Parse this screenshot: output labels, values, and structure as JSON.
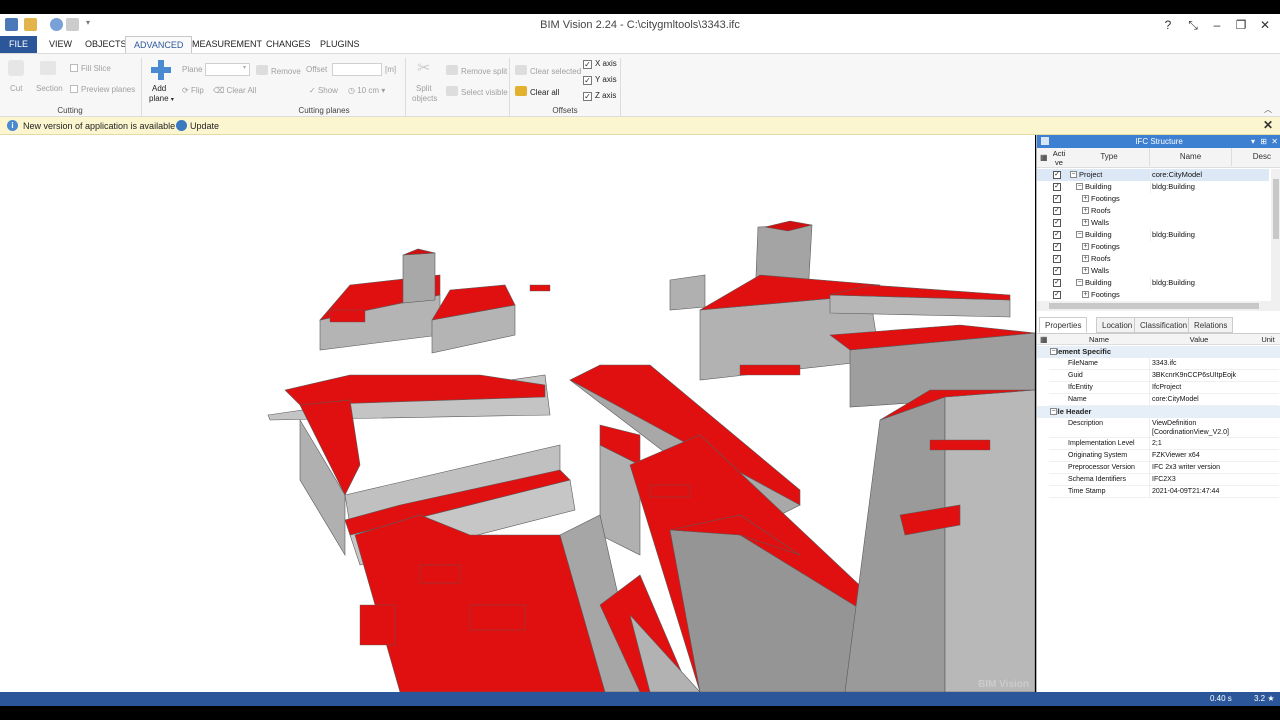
{
  "window": {
    "title": "BIM Vision 2.24 - C:\\citygmltools\\3343.ifc",
    "controls": [
      "?",
      "⤡",
      "–",
      "❐",
      "✕"
    ]
  },
  "menu": {
    "tabs": [
      "FILE",
      "VIEW",
      "OBJECTS",
      "ADVANCED",
      "MEASUREMENT",
      "CHANGES",
      "PLUGINS"
    ]
  },
  "ribbon": {
    "cut": "Cut",
    "section": "Section",
    "fill_slice": "Fill Slice",
    "preview_planes": "Preview planes",
    "cutting_group": "Cutting",
    "add_plane": "Add",
    "add_plane2": "plane",
    "plane_label": "Plane",
    "remove": "Remove",
    "flip": "Flip",
    "clear_all_planes": "Clear All",
    "offset_label": "Offset",
    "offset_unit": "[m]",
    "show": "Show",
    "step": "10 cm",
    "cutting_planes_group": "Cutting planes",
    "split_objects": "Split",
    "split_objects2": "objects",
    "remove_split": "Remove split",
    "select_visible": "Select visible",
    "clear_selected": "Clear selected",
    "clear_all": "Clear all",
    "offsets_group": "Offsets",
    "x_axis": "X axis",
    "y_axis": "Y axis",
    "z_axis": "Z axis"
  },
  "notification": {
    "message": "New version of application is available",
    "action": "Update"
  },
  "viewport": {
    "watermark": "BIM Vision"
  },
  "ifc": {
    "title": "IFC Structure",
    "cols": {
      "active": "Acti",
      "active2": "ve",
      "type": "Type",
      "name": "Name",
      "desc": "Desc"
    },
    "rows": [
      {
        "type": "Project",
        "name": "core:CityModel",
        "indent": 0,
        "sign": "−"
      },
      {
        "type": "Building",
        "name": "bldg:Building",
        "indent": 1,
        "sign": "−"
      },
      {
        "type": "Footings",
        "name": "",
        "indent": 2,
        "sign": "+"
      },
      {
        "type": "Roofs",
        "name": "",
        "indent": 2,
        "sign": "+"
      },
      {
        "type": "Walls",
        "name": "",
        "indent": 2,
        "sign": "+"
      },
      {
        "type": "Building",
        "name": "bldg:Building",
        "indent": 1,
        "sign": "−"
      },
      {
        "type": "Footings",
        "name": "",
        "indent": 2,
        "sign": "+"
      },
      {
        "type": "Roofs",
        "name": "",
        "indent": 2,
        "sign": "+"
      },
      {
        "type": "Walls",
        "name": "",
        "indent": 2,
        "sign": "+"
      },
      {
        "type": "Building",
        "name": "bldg:Building",
        "indent": 1,
        "sign": "−"
      },
      {
        "type": "Footings",
        "name": "",
        "indent": 2,
        "sign": "+"
      }
    ]
  },
  "props": {
    "tabs": [
      "Properties",
      "Location",
      "Classification",
      "Relations"
    ],
    "cols": {
      "name": "Name",
      "value": "Value",
      "unit": "Unit"
    },
    "sections": [
      {
        "title": "Element Specific",
        "rows": [
          [
            "FileName",
            "3343.ifc"
          ],
          [
            "Guid",
            "3BKcnrK9nCCP6sUItpEojk"
          ],
          [
            "IfcEntity",
            "IfcProject"
          ],
          [
            "Name",
            "core:CityModel"
          ]
        ]
      },
      {
        "title": "File Header",
        "rows": [
          [
            "Description",
            "ViewDefinition [CoordinationView_V2.0]"
          ],
          [
            "Implementation Level",
            "2;1"
          ],
          [
            "Originating System",
            "FZKViewer x64"
          ],
          [
            "Preprocessor Version",
            "IFC 2x3 writer version"
          ],
          [
            "Schema Identifiers",
            "IFC2X3"
          ],
          [
            "Time Stamp",
            "2021-04-09T21:47:44"
          ]
        ]
      }
    ]
  },
  "status": {
    "time": "0.40 s",
    "zoom": "3.2 ★"
  },
  "colors": {
    "accent": "#2b579a",
    "roof": "#e01010",
    "wall": "#a8a8a8"
  }
}
